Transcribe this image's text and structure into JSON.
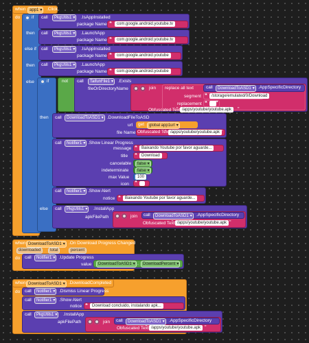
{
  "ev1": {
    "when": "when",
    "comp": "app1",
    "evt": ".Click",
    "do": "do"
  },
  "if": {
    "if": "if",
    "then": "then",
    "elseif": "else if",
    "else": "else"
  },
  "call": "call",
  "utils": "PkgUtils1",
  "isInstalled": ".IsAppInstalled",
  "launchApp": ".LaunchApp",
  "installApp": ".InstallApp",
  "pkgName": "package Name",
  "pkgTv": "com.google.android.youtube.tv",
  "pkgYt": "com.google.android.youtube",
  "notWord": "not",
  "taifun": "TaifunFile1",
  "exists": ".Exists",
  "fileOrDir": "fileOrDirectoryName",
  "joinWord": "join",
  "replaceAll": "replace all text",
  "segment": "segment",
  "replacement": "replacement",
  "storagePath": "/storage/emulated/0/Download",
  "emptyStr": "",
  "downloader": "DownloadToASD1",
  "appSpecDir": ".AppSpecificDirectory",
  "obfuscated": "Obfuscated Text",
  "apkPath": "/apps/youtube/youtube.apk",
  "downloadFileToASD": ".DownloadFileToASD",
  "urlLbl": "url",
  "getWord": "get",
  "globalUrl": "global app1url",
  "fileNameLbl": "file Name",
  "notifier": "Notifier1",
  "showLinear": ".Show Linear Progress",
  "messageLbl": "message",
  "msgText": "Baixando Youtube por favor aguarde...",
  "titleLbl": "title",
  "titleText": "Download",
  "cancelableLbl": "cancelable",
  "falseWord": "false",
  "indeterminateLbl": "indeterminate",
  "maxValueLbl": "max Value",
  "maxVal": "100",
  "iconLbl": "icon",
  "showAlert": ".Show Alert",
  "noticeLbl": "notice",
  "apkFilePathLbl": "apkFilePath",
  "ev2": {
    "when": "when",
    "comp": "DownloadToASD1",
    "evt": ".On Download Progress Changed",
    "p1": "downloaded",
    "p2": "total",
    "p3": "percent",
    "do": "do"
  },
  "updateProgress": ".Update Progress",
  "valueLbl": "value",
  "dlPercent": "DownloadPercent",
  "ev3": {
    "when": "when",
    "comp": "DownloadToASD1",
    "evt": ".DownloadCompleted",
    "do": "do"
  },
  "dismissLinear": ".Dismiss Linear Progress",
  "completedMsg": "Download concluido, instalando apk..."
}
